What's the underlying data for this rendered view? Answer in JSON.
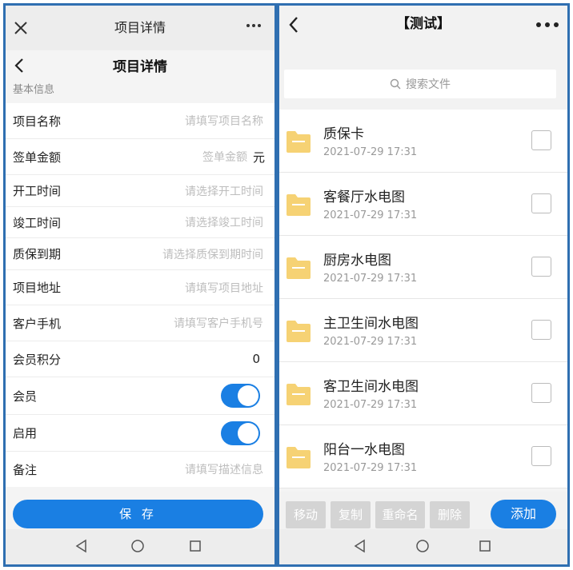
{
  "left": {
    "topbar": {
      "title": "项目详情",
      "close_icon": "close-icon",
      "more_icon": "more-icon"
    },
    "header": {
      "title": "项目详情",
      "back_icon": "back-icon"
    },
    "section_label": "基本信息",
    "fields": [
      {
        "label": "项目名称",
        "placeholder": "请填写项目名称"
      },
      {
        "label": "签单金额",
        "placeholder": "签单金额",
        "unit": "元"
      },
      {
        "label": "开工时间",
        "placeholder": "请选择开工时间"
      },
      {
        "label": "竣工时间",
        "placeholder": "请选择竣工时间"
      },
      {
        "label": "质保到期",
        "placeholder": "请选择质保到期时间"
      },
      {
        "label": "项目地址",
        "placeholder": "请填写项目地址"
      },
      {
        "label": "客户手机",
        "placeholder": "请填写客户手机号"
      },
      {
        "label": "会员积分",
        "value": "0"
      },
      {
        "label": "会员",
        "toggle_on": true
      },
      {
        "label": "启用",
        "toggle_on": true
      },
      {
        "label": "备注",
        "placeholder": "请填写描述信息"
      }
    ],
    "save_label": "保 存",
    "accent": "#1a7fe3"
  },
  "right": {
    "header": {
      "title": "【测试】",
      "back_icon": "back-icon",
      "more_icon": "more-icon"
    },
    "search": {
      "placeholder": "搜索文件",
      "icon": "search-icon"
    },
    "files": [
      {
        "name": "质保卡",
        "date": "2021-07-29 17:31"
      },
      {
        "name": "客餐厅水电图",
        "date": "2021-07-29 17:31"
      },
      {
        "name": "厨房水电图",
        "date": "2021-07-29 17:31"
      },
      {
        "name": "主卫生间水电图",
        "date": "2021-07-29 17:31"
      },
      {
        "name": "客卫生间水电图",
        "date": "2021-07-29 17:31"
      },
      {
        "name": "阳台一水电图",
        "date": "2021-07-29 17:31"
      }
    ],
    "toolbar": {
      "move": "移动",
      "copy": "复制",
      "rename": "重命名",
      "delete": "删除",
      "add": "添加"
    },
    "folder_color": "#f6d274"
  },
  "nav": {
    "back_icon": "nav-back-icon",
    "home_icon": "nav-home-icon",
    "recents_icon": "nav-recents-icon"
  }
}
